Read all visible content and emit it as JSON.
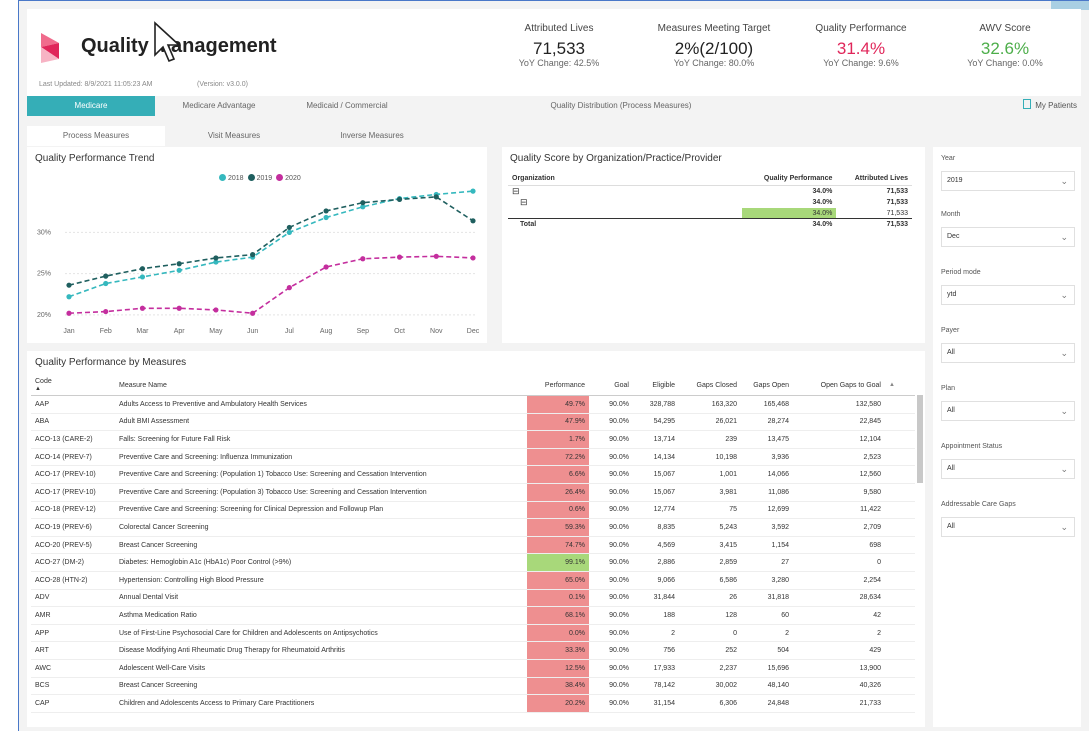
{
  "header": {
    "title": "Quality Management",
    "last_updated": "Last Updated: 8/9/2021 11:05:23 AM",
    "version": "(Version: v3.0.0)"
  },
  "kpis": [
    {
      "label": "Attributed Lives",
      "value": "71,533",
      "yoy": "YoY Change: 42.5%",
      "color": "#222222"
    },
    {
      "label": "Measures Meeting Target",
      "value": "2%(2/100)",
      "yoy": "YoY Change: 80.0%",
      "color": "#222222"
    },
    {
      "label": "Quality Performance",
      "value": "31.4%",
      "yoy": "YoY Change: 9.6%",
      "color": "#e0265a"
    },
    {
      "label": "AWV Score",
      "value": "32.6%",
      "yoy": "YoY Change: 0.0%",
      "color": "#4dae4a"
    }
  ],
  "tabs_primary": [
    "Medicare",
    "Medicare Advantage",
    "Medicaid / Commercial",
    "Quality Distribution (Process Measures)"
  ],
  "my_patients": "My Patients",
  "tabs_secondary": [
    "Process Measures",
    "Visit Measures",
    "Inverse Measures"
  ],
  "trend": {
    "title": "Quality Performance Trend",
    "legend": [
      "2018",
      "2019",
      "2020"
    ]
  },
  "chart_data": {
    "type": "line",
    "x": [
      "Jan",
      "Feb",
      "Mar",
      "Apr",
      "May",
      "Jun",
      "Jul",
      "Aug",
      "Sep",
      "Oct",
      "Nov",
      "Dec"
    ],
    "y_ticks": [
      "20%",
      "25%",
      "30%"
    ],
    "ylim": [
      19.5,
      35.5
    ],
    "series": [
      {
        "name": "2018",
        "color": "#35b8be",
        "values": [
          22.2,
          23.8,
          24.6,
          25.4,
          26.4,
          27.0,
          30.0,
          31.8,
          33.1,
          34.1,
          34.6,
          35.0
        ]
      },
      {
        "name": "2019",
        "color": "#1f5f5f",
        "values": [
          23.6,
          24.7,
          25.6,
          26.2,
          26.9,
          27.3,
          30.6,
          32.6,
          33.6,
          34.0,
          34.3,
          31.4
        ]
      },
      {
        "name": "2020",
        "color": "#c42e9e",
        "values": [
          20.2,
          20.4,
          20.8,
          20.8,
          20.6,
          20.2,
          23.3,
          25.8,
          26.8,
          27.0,
          27.1,
          26.9
        ]
      }
    ]
  },
  "org": {
    "title": "Quality Score by Organization/Practice/Provider",
    "headers": [
      "Organization",
      "Quality Performance",
      "Attributed Lives"
    ],
    "rows": [
      {
        "icon": "⊟",
        "perf": "34.0%",
        "lives": "71,533"
      },
      {
        "icon": "⊟",
        "perf": "34.0%",
        "lives": "71,533"
      },
      {
        "icon": "",
        "perf": "34.0%",
        "lives": "71,533"
      }
    ],
    "total_label": "Total",
    "total_perf": "34.0%",
    "total_lives": "71,533"
  },
  "filters": [
    {
      "label": "Year",
      "value": "2019"
    },
    {
      "label": "Month",
      "value": "Dec"
    },
    {
      "label": "Period mode",
      "value": "ytd"
    },
    {
      "label": "Payer",
      "value": "All"
    },
    {
      "label": "Plan",
      "value": "All"
    },
    {
      "label": "Appointment Status",
      "value": "All"
    },
    {
      "label": "Addressable Care Gaps",
      "value": "All"
    }
  ],
  "measures": {
    "title": "Quality Performance by Measures",
    "headers": [
      "Code",
      "Measure Name",
      "Performance",
      "Goal",
      "Eligible",
      "Gaps Closed",
      "Gaps Open",
      "Open Gaps to Goal"
    ],
    "rows": [
      [
        "AAP",
        "Adults Access to Preventive and Ambulatory Health Services",
        "49.7%",
        "90.0%",
        "328,788",
        "163,320",
        "165,468",
        "132,580"
      ],
      [
        "ABA",
        "Adult BMI Assessment",
        "47.9%",
        "90.0%",
        "54,295",
        "26,021",
        "28,274",
        "22,845"
      ],
      [
        "ACO-13 (CARE-2)",
        "Falls: Screening for Future Fall Risk",
        "1.7%",
        "90.0%",
        "13,714",
        "239",
        "13,475",
        "12,104"
      ],
      [
        "ACO-14 (PREV-7)",
        "Preventive Care and Screening: Influenza Immunization",
        "72.2%",
        "90.0%",
        "14,134",
        "10,198",
        "3,936",
        "2,523"
      ],
      [
        "ACO-17 (PREV-10)",
        "Preventive Care and Screening: (Population 1) Tobacco Use: Screening and Cessation Intervention",
        "6.6%",
        "90.0%",
        "15,067",
        "1,001",
        "14,066",
        "12,560"
      ],
      [
        "ACO-17 (PREV-10)",
        "Preventive Care and Screening: (Population 3) Tobacco Use: Screening and Cessation Intervention",
        "26.4%",
        "90.0%",
        "15,067",
        "3,981",
        "11,086",
        "9,580"
      ],
      [
        "ACO-18 (PREV-12)",
        "Preventive Care and Screening: Screening for Clinical Depression and Followup Plan",
        "0.6%",
        "90.0%",
        "12,774",
        "75",
        "12,699",
        "11,422"
      ],
      [
        "ACO-19 (PREV-6)",
        "Colorectal Cancer Screening",
        "59.3%",
        "90.0%",
        "8,835",
        "5,243",
        "3,592",
        "2,709"
      ],
      [
        "ACO-20 (PREV-5)",
        "Breast Cancer Screening",
        "74.7%",
        "90.0%",
        "4,569",
        "3,415",
        "1,154",
        "698"
      ],
      [
        "ACO-27 (DM-2)",
        "Diabetes: Hemoglobin A1c (HbA1c) Poor Control (>9%)",
        "99.1%",
        "90.0%",
        "2,886",
        "2,859",
        "27",
        "0"
      ],
      [
        "ACO-28 (HTN-2)",
        "Hypertension: Controlling High Blood Pressure",
        "65.0%",
        "90.0%",
        "9,066",
        "6,586",
        "3,280",
        "2,254"
      ],
      [
        "ADV",
        "Annual Dental Visit",
        "0.1%",
        "90.0%",
        "31,844",
        "26",
        "31,818",
        "28,634"
      ],
      [
        "AMR",
        "Asthma Medication Ratio",
        "68.1%",
        "90.0%",
        "188",
        "128",
        "60",
        "42"
      ],
      [
        "APP",
        "Use of First-Line Psychosocial Care for Children and Adolescents on Antipsychotics",
        "0.0%",
        "90.0%",
        "2",
        "0",
        "2",
        "2"
      ],
      [
        "ART",
        "Disease Modifying Anti Rheumatic Drug Therapy for Rheumatoid Arthritis",
        "33.3%",
        "90.0%",
        "756",
        "252",
        "504",
        "429"
      ],
      [
        "AWC",
        "Adolescent Well-Care Visits",
        "12.5%",
        "90.0%",
        "17,933",
        "2,237",
        "15,696",
        "13,900"
      ],
      [
        "BCS",
        "Breast Cancer Screening",
        "38.4%",
        "90.0%",
        "78,142",
        "30,002",
        "48,140",
        "40,326"
      ],
      [
        "CAP",
        "Children and Adolescents Access to Primary Care Practitioners",
        "20.2%",
        "90.0%",
        "31,154",
        "6,306",
        "24,848",
        "21,733"
      ]
    ],
    "perf_good_color": "#a8d87a",
    "perf_bad_color": "#ee8f90"
  }
}
